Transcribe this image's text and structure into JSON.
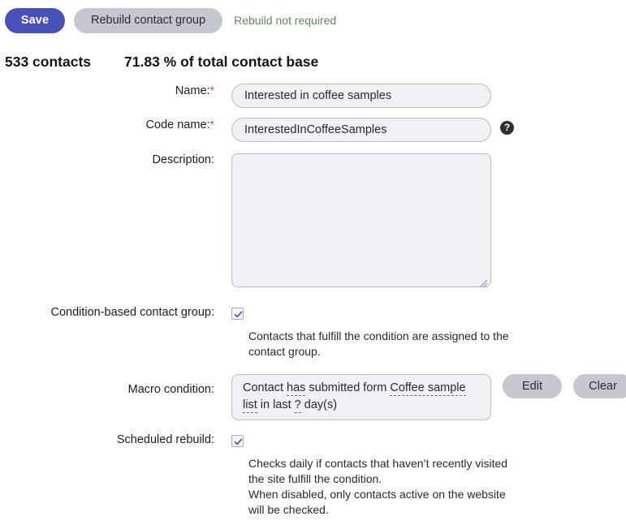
{
  "toolbar": {
    "save_label": "Save",
    "rebuild_label": "Rebuild contact group",
    "rebuild_status": "Rebuild not required",
    "status_color": "#5f8a56",
    "save_color": "#4850b9"
  },
  "summary": {
    "contacts": "533 contacts",
    "percentage": "71.83 % of total contact base"
  },
  "form": {
    "name": {
      "label": "Name:",
      "required_marker": "*",
      "value": "Interested in coffee samples",
      "placeholder": ""
    },
    "code_name": {
      "label": "Code name:",
      "required_marker": "*",
      "value": "InterestedInCoffeeSamples",
      "placeholder": "",
      "help_icon": "question-mark-icon",
      "help_glyph": "?"
    },
    "description": {
      "label": "Description:",
      "value": "",
      "placeholder": ""
    },
    "condition_based": {
      "label": "Condition-based contact group:",
      "checked": true,
      "hint": "Contacts that fulfill the condition are assigned to the contact group."
    },
    "macro_condition": {
      "label": "Macro condition:",
      "text_part_1": "Contact ",
      "token_1": "has",
      "text_part_2": " submitted form ",
      "token_2": "Coffee sample list",
      "text_part_3": " in last ",
      "token_3": "?",
      "text_part_4": " day(s)",
      "edit_label": "Edit",
      "clear_label": "Clear"
    },
    "scheduled_rebuild": {
      "label": "Scheduled rebuild:",
      "checked": true,
      "hint_line_1": "Checks daily if contacts that haven’t recently visited the site fulfill the condition.",
      "hint_line_2": "When disabled, only contacts active on the website will be checked."
    }
  }
}
